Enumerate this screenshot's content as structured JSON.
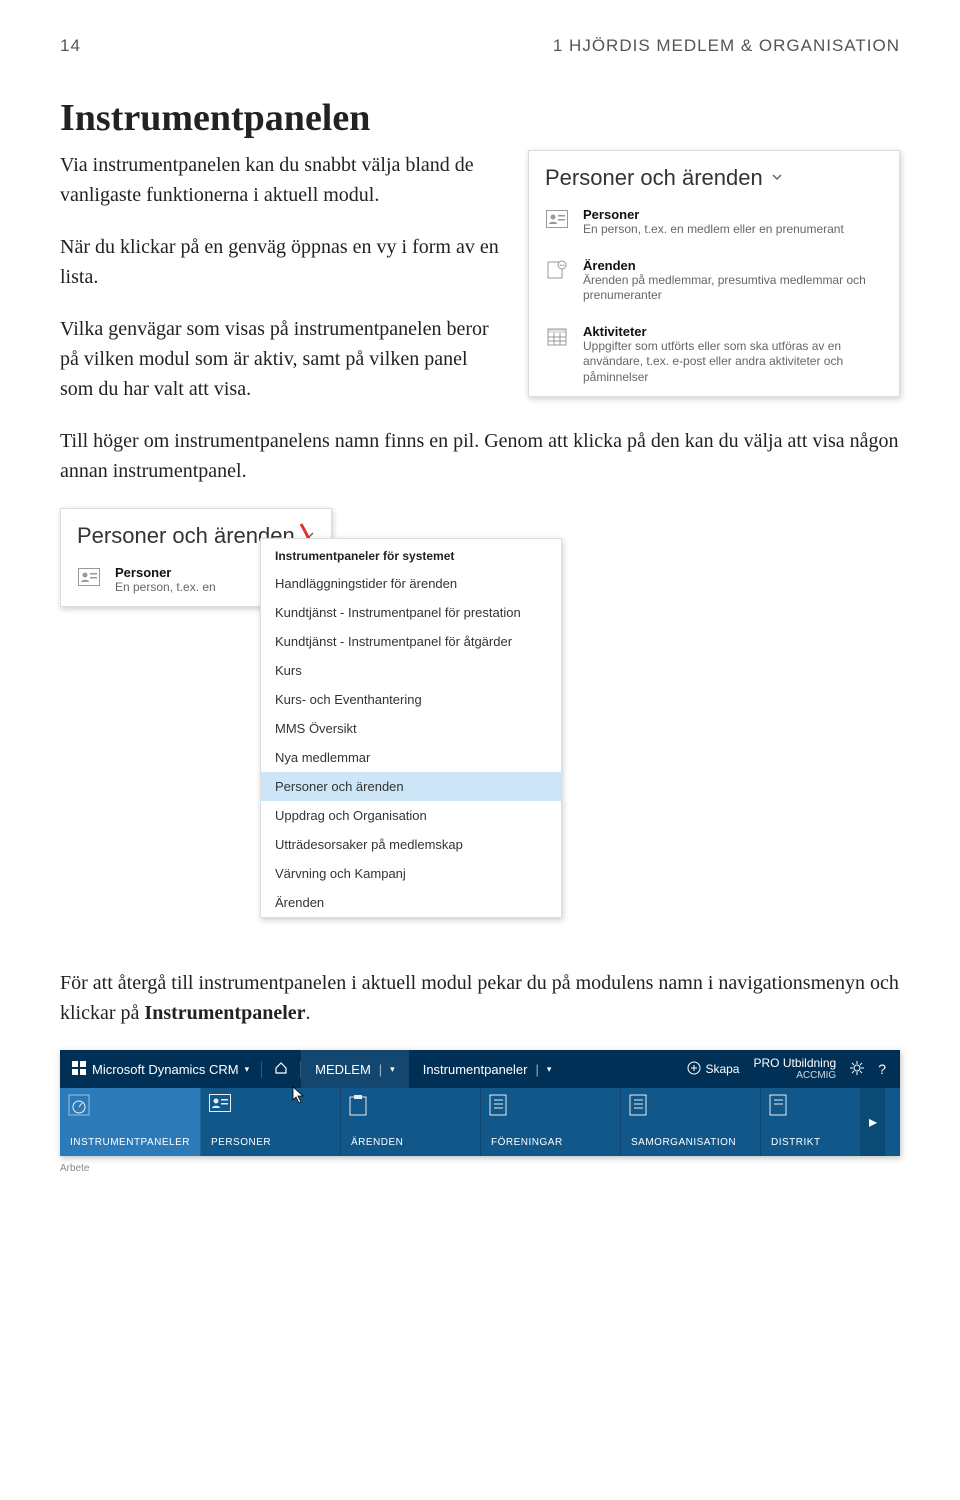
{
  "header": {
    "page_number": "14",
    "running_head": "1  HJÖRDIS MEDLEM & ORGANISATION"
  },
  "section": {
    "title": "Instrumentpanelen",
    "p1": "Via instrumentpanelen kan du snabbt välja bland de vanligaste funktionerna i aktuell modul.",
    "p2": "När du klickar på en genväg öppnas en vy i form av en lista.",
    "p3": "Vilka genvägar som visas på instrumentpanelen beror på vilken modul som är aktiv, samt på vilken panel som du har valt att visa.",
    "p4": "Till höger om instrumentpanelens namn finns en pil. Genom att klicka på den kan du välja att visa någon annan instrumentpanel.",
    "p5a": "För att återgå till instrumentpanelen i aktuell modul pekar du på modulens namn i navigationsmenyn och klickar på ",
    "p5b": "Instrumentpaneler",
    "p5c": "."
  },
  "figure1": {
    "title": "Personer och ärenden",
    "items": [
      {
        "title": "Personer",
        "desc": "En person, t.ex. en medlem eller en prenumerant"
      },
      {
        "title": "Ärenden",
        "desc": "Ärenden på medlemmar, presumtiva medlemmar och prenumeranter"
      },
      {
        "title": "Aktiviteter",
        "desc": "Uppgifter som utförts eller som ska utföras av en användare, t.ex. e-post eller andra aktiviteter och påminnelser"
      }
    ]
  },
  "figure2": {
    "left_title": "Personer och ärenden",
    "left_item_title": "Personer",
    "left_item_desc": "En person, t.ex. en",
    "menu_header": "Instrumentpaneler för systemet",
    "menu_items": [
      "Handläggningstider för ärenden",
      "Kundtjänst - Instrumentpanel för prestation",
      "Kundtjänst - Instrumentpanel för åtgärder",
      "Kurs",
      "Kurs- och Eventhantering",
      "MMS Översikt",
      "Nya medlemmar",
      "Personer och ärenden",
      "Uppdrag och Organisation",
      "Utträdesorsaker på medlemskap",
      "Värvning och Kampanj",
      "Ärenden"
    ],
    "selected_index": 7
  },
  "nav": {
    "brand": "Microsoft Dynamics CRM",
    "active_tab": "MEDLEM",
    "crumb": "Instrumentpaneler",
    "skapa": "Skapa",
    "user": "PRO Utbildning",
    "org": "ACCMIG",
    "subline": "Arbete",
    "tiles": [
      "INSTRUMENTPANELER",
      "PERSONER",
      "ÄRENDEN",
      "FÖRENINGAR",
      "SAMORGANISATION",
      "DISTRIKT"
    ]
  }
}
